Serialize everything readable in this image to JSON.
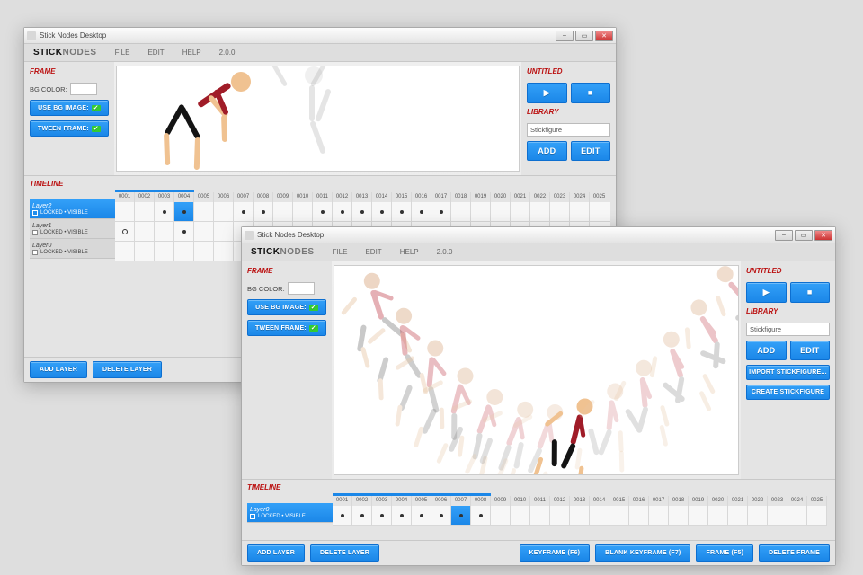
{
  "app_title": "Stick Nodes Desktop",
  "brand": {
    "a": "STICK",
    "b": "NODES"
  },
  "menu": {
    "file": "FILE",
    "edit": "EDIT",
    "help": "HELP",
    "ver": "2.0.0"
  },
  "frame_panel": {
    "title": "FRAME",
    "bg_label": "BG COLOR:",
    "use_bg": "USE BG IMAGE:",
    "tween": "TWEEN FRAME:"
  },
  "right": {
    "project": "UNTITLED",
    "library": "LIBRARY",
    "lib_item": "Stickfigure",
    "add": "ADD",
    "edit": "EDIT",
    "import": "IMPORT STICKFIGURE...",
    "create": "CREATE STICKFIGURE"
  },
  "timeline": {
    "title": "TIMELINE",
    "locked": "LOCKED",
    "visible": "VISIBLE",
    "winA": {
      "layers": [
        "Layer2",
        "Layer1",
        "Layer0"
      ],
      "num_frames": 28,
      "selected": 4,
      "playhead_width": 88,
      "keys": {
        "0": [
          3,
          4,
          7,
          8,
          11,
          12,
          13,
          14,
          15,
          16,
          17
        ],
        "1": [
          4,
          7
        ],
        "2": []
      },
      "open_keys": {
        "1": [
          1
        ]
      }
    },
    "winB": {
      "layers": [
        "Layer0"
      ],
      "num_frames": 25,
      "selected": 7,
      "playhead_width": 176,
      "keys": {
        "0": [
          1,
          2,
          3,
          4,
          5,
          6,
          7,
          8
        ]
      }
    }
  },
  "footer": {
    "add_layer": "ADD LAYER",
    "del_layer": "DELETE LAYER",
    "keyframe": "KEYFRAME (F6)",
    "blank_kf": "BLANK KEYFRAME (F7)",
    "frame": "FRAME (F5)",
    "del_frame": "DELETE FRAME"
  },
  "icons": {
    "play": "▶",
    "stop": "■",
    "min": "–",
    "max": "▭",
    "close": "✕"
  }
}
